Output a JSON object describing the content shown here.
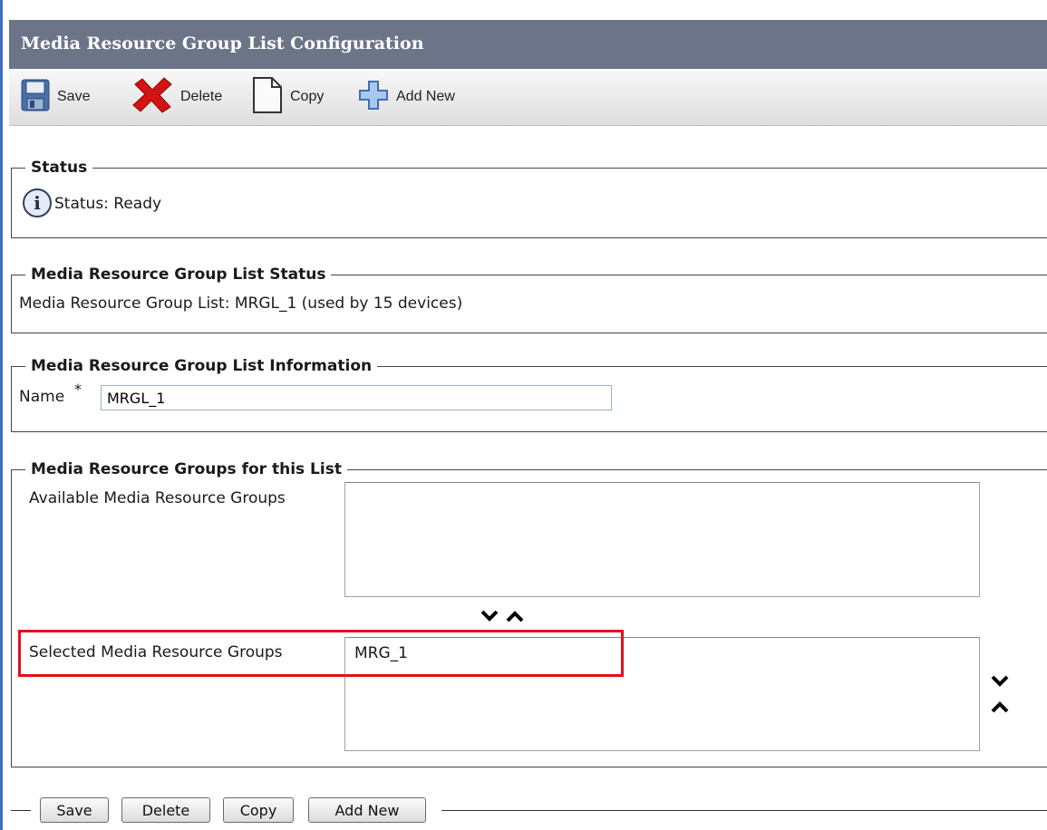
{
  "page": {
    "title": "Media Resource Group List Configuration"
  },
  "toolbar": {
    "save_label": "Save",
    "delete_label": "Delete",
    "copy_label": "Copy",
    "add_new_label": "Add New"
  },
  "status_section": {
    "legend": "Status",
    "text": "Status: Ready",
    "icon": "info-icon"
  },
  "mrgl_status_section": {
    "legend": "Media Resource Group List Status",
    "text": "Media Resource Group List: MRGL_1 (used by 15 devices)"
  },
  "info_section": {
    "legend": "Media Resource Group List Information",
    "name_label": "Name",
    "required_mark": "*",
    "name_value": "MRGL_1"
  },
  "groups_section": {
    "legend": "Media Resource Groups for this List",
    "available_label": "Available Media Resource Groups",
    "available_items": [],
    "selected_label": "Selected Media Resource Groups",
    "selected_items": [
      "MRG_1"
    ]
  },
  "bottom_buttons": {
    "save": "Save",
    "delete": "Delete",
    "copy": "Copy",
    "add_new": "Add New"
  },
  "colors": {
    "titlebar": "#6b7587",
    "highlight": "#e2101b",
    "left_rule": "#3f6fc2"
  }
}
